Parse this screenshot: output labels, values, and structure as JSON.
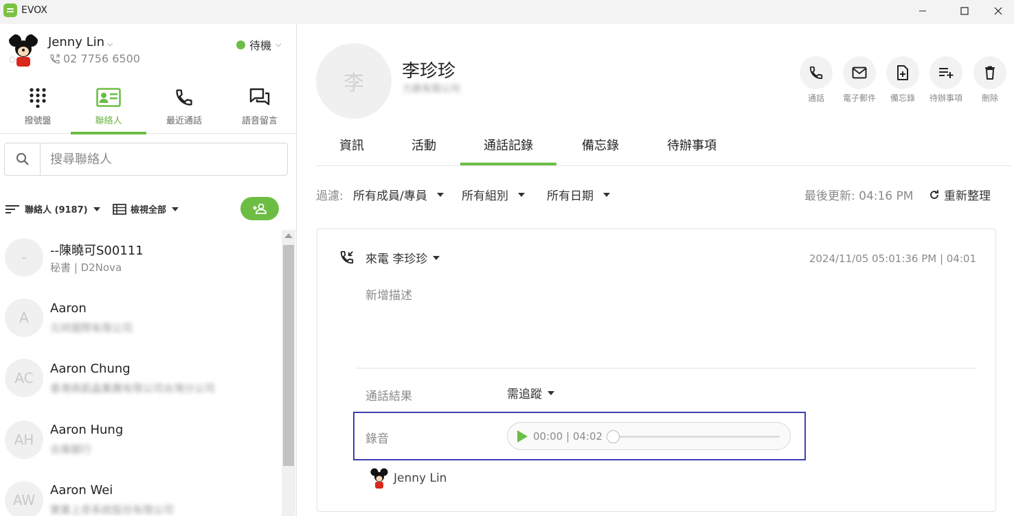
{
  "window": {
    "title": "EVOX"
  },
  "user": {
    "name": "Jenny Lin",
    "phone": "02 7756 6500",
    "status": "待機",
    "status_color": "#6dbd45"
  },
  "nav": [
    {
      "label": "撥號盤",
      "icon": "dialpad-icon",
      "active": false
    },
    {
      "label": "聯絡人",
      "icon": "contact-card-icon",
      "active": true
    },
    {
      "label": "最近通話",
      "icon": "phone-icon",
      "active": false
    },
    {
      "label": "語音留言",
      "icon": "chat-bubbles-icon",
      "active": false
    }
  ],
  "search": {
    "placeholder": "搜尋聯絡人"
  },
  "listbar": {
    "sort_label": "聯絡人 (9187)",
    "view_label": "檢視全部"
  },
  "contacts": [
    {
      "initials": "-",
      "name": "--陳曉可S00111",
      "sub": "秘書 | D2Nova",
      "sub_blurred": false
    },
    {
      "initials": "A",
      "name": "Aaron",
      "sub": "元祥國際有限公司",
      "sub_blurred": true
    },
    {
      "initials": "AC",
      "name": "Aaron Chung",
      "sub": "香港商凱晶集團有限公司台灣分公司",
      "sub_blurred": true
    },
    {
      "initials": "AH",
      "name": "Aaron Hung",
      "sub": "合庫銀行",
      "sub_blurred": true
    },
    {
      "initials": "AW",
      "name": "Aaron Wei",
      "sub": "實業上奇系統股份有限公司",
      "sub_blurred": true
    }
  ],
  "contact_detail": {
    "initial": "李",
    "name": "李珍珍",
    "company": "力鼎有限公司",
    "actions": [
      {
        "label": "通話",
        "icon": "phone-icon"
      },
      {
        "label": "電子郵件",
        "icon": "mail-icon"
      },
      {
        "label": "備忘錄",
        "icon": "note-add-icon"
      },
      {
        "label": "待辦事項",
        "icon": "task-add-icon"
      },
      {
        "label": "刪除",
        "icon": "trash-icon"
      }
    ],
    "tabs": [
      "資訊",
      "活動",
      "通話記錄",
      "備忘錄",
      "待辦事項"
    ],
    "active_tab": "通話記錄"
  },
  "filters": {
    "label": "過濾:",
    "member": "所有成員/專員",
    "group": "所有組別",
    "date": "所有日期",
    "last_updated": "最後更新: 04:16 PM",
    "refresh": "重新整理"
  },
  "call_record": {
    "type": "來電 李珍珍",
    "timestamp": "2024/11/05 05:01:36 PM | 04:01",
    "description_placeholder": "新增描述",
    "result_label": "通話結果",
    "result_value": "需追蹤",
    "recording_label": "錄音",
    "player_time": "00:00 | 04:02",
    "player_progress": 0,
    "owner": "Jenny Lin"
  },
  "colors": {
    "accent": "#6dbd45",
    "highlight_box": "#3d3db0"
  }
}
